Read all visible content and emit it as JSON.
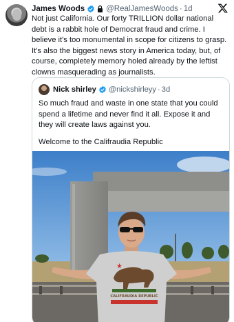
{
  "post": {
    "author_name": "James Woods",
    "author_handle": "@RealJamesWoods",
    "separator": "·",
    "timestamp": "1d",
    "text": "Not just California. Our forty TRILLION dollar national debt is a rabbit hole of Democrat fraud and crime. I believe it's too monumental in scope for citizens to grasp. It's also the biggest news story in America today, but, of course, completely memory holed already by the leftist clowns masquerading as journalists."
  },
  "quoted": {
    "author_name": "Nick shirley",
    "author_handle": "@nickshirleyy",
    "separator": "·",
    "timestamp": "3d",
    "text": "So much fraud and waste in one state that you could spend a lifetime and never find it all. Expose it and they will create laws against you.",
    "text2": "Welcome to the Califraudia Republic",
    "shirt_text": "CALIFRAUDIA REPUBLIC"
  },
  "icons": {
    "verified": "verified-badge-icon",
    "lock": "lock-icon",
    "platform": "x-logo-icon"
  },
  "colors": {
    "verified_blue": "#1d9bf0",
    "muted_text": "#536471",
    "border": "#cfd9de"
  }
}
